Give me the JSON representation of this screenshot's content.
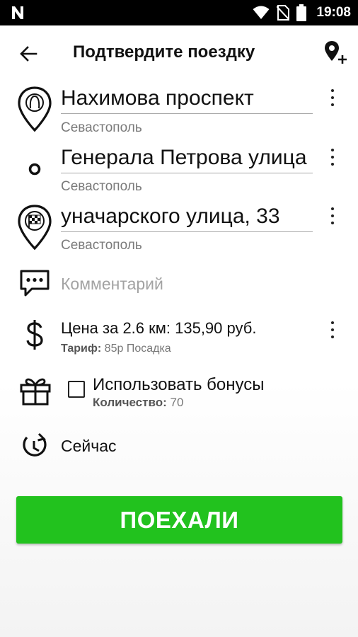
{
  "status_bar": {
    "time": "19:08",
    "icons": [
      "n-icon",
      "wifi-icon",
      "no-sim-icon",
      "battery-icon"
    ]
  },
  "header": {
    "title": "Подтвердите поездку",
    "back_icon": "arrow-left-icon",
    "add_stop_icon": "add-location-icon"
  },
  "route": [
    {
      "address": "Нахимова проспект",
      "city": "Севастополь",
      "icon": "pickup-pin-icon"
    },
    {
      "address": "Генерала Петрова улица",
      "city": "Севастополь",
      "icon": "waypoint-dot-icon"
    },
    {
      "address": "уначарского улица, 33",
      "city": "Севастополь",
      "icon": "finish-flag-pin-icon"
    }
  ],
  "comment": {
    "placeholder": "Комментарий",
    "icon": "comment-icon"
  },
  "price": {
    "text": "Цена за 2.6 км: 135,90 руб.",
    "tariff_label": "Тариф:",
    "tariff_value": "85р Посадка",
    "icon": "dollar-icon"
  },
  "bonus": {
    "label": "Использовать бонусы",
    "checked": false,
    "quantity_label": "Количество:",
    "quantity_value": "70",
    "icon": "gift-icon"
  },
  "when": {
    "label": "Сейчас",
    "icon": "clock-icon"
  },
  "action": {
    "label": "ПОЕХАЛИ",
    "color": "#22c21e"
  }
}
